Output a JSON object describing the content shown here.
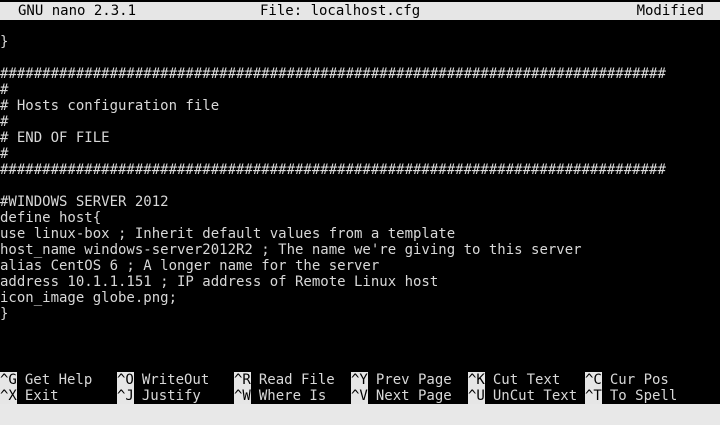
{
  "titlebar": {
    "app": "GNU nano 2.3.1",
    "file": "File: localhost.cfg",
    "status": "Modified"
  },
  "editor": {
    "lines": [
      "}",
      "",
      "###############################################################################",
      "#",
      "# Hosts configuration file",
      "#",
      "# END OF FILE",
      "#",
      "###############################################################################",
      "",
      "#WINDOWS SERVER 2012",
      "define host{",
      "use linux-box ; Inherit default values from a template",
      "host_name windows-server2012R2 ; The name we're giving to this server",
      "alias CentOS 6 ; A longer name for the server",
      "address 10.1.1.151 ; IP address of Remote Linux host",
      "icon_image globe.png;",
      "}"
    ]
  },
  "shortcuts": {
    "row1": [
      {
        "key": "^G",
        "label": "Get Help"
      },
      {
        "key": "^O",
        "label": "WriteOut"
      },
      {
        "key": "^R",
        "label": "Read File"
      },
      {
        "key": "^Y",
        "label": "Prev Page"
      },
      {
        "key": "^K",
        "label": "Cut Text"
      },
      {
        "key": "^C",
        "label": "Cur Pos"
      }
    ],
    "row2": [
      {
        "key": "^X",
        "label": "Exit"
      },
      {
        "key": "^J",
        "label": "Justify"
      },
      {
        "key": "^W",
        "label": "Where Is"
      },
      {
        "key": "^V",
        "label": "Next Page"
      },
      {
        "key": "^U",
        "label": "UnCut Text"
      },
      {
        "key": "^T",
        "label": "To Spell"
      }
    ]
  }
}
